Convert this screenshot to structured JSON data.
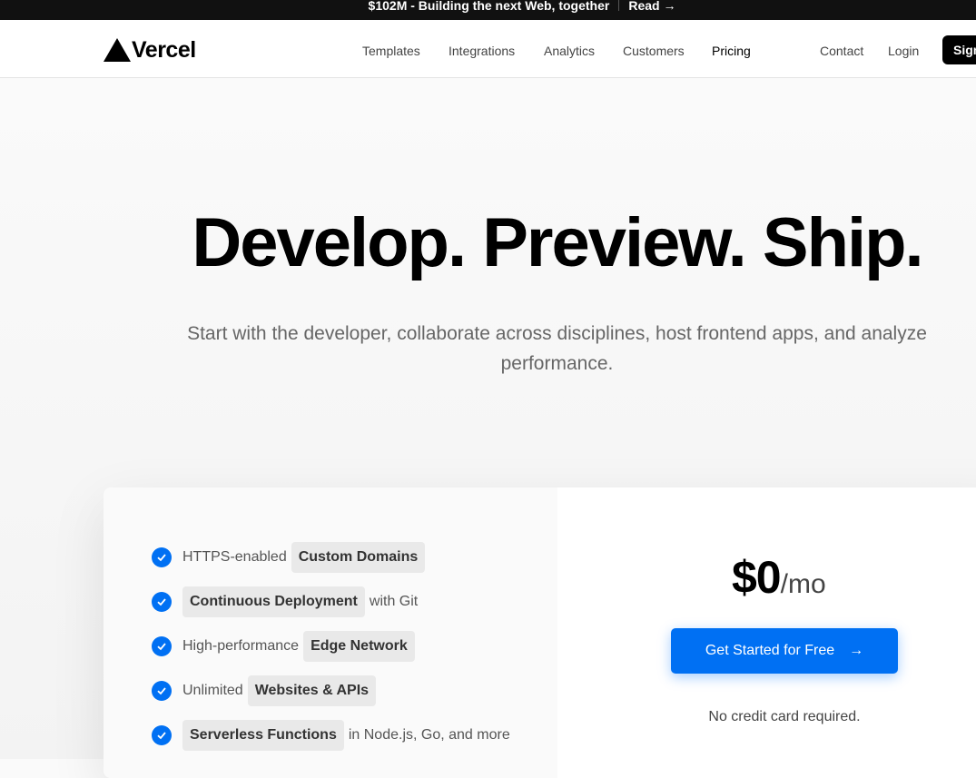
{
  "announcement": {
    "text": "$102M - Building the next Web, together",
    "link": "Read →"
  },
  "brand": {
    "name": "Vercel"
  },
  "nav": {
    "items": [
      {
        "label": "Templates"
      },
      {
        "label": "Integrations"
      },
      {
        "label": "Analytics"
      },
      {
        "label": "Customers"
      },
      {
        "label": "Pricing"
      }
    ],
    "contact": "Contact",
    "login": "Login",
    "signup": "Sign Up"
  },
  "hero": {
    "title": "Develop. Preview. Ship.",
    "subtitle": "Start with the developer, collaborate across disciplines, host frontend apps, and analyze performance."
  },
  "pricing": {
    "features": [
      {
        "before": "HTTPS-enabled",
        "highlight": "Custom Domains",
        "after": ""
      },
      {
        "before": "",
        "highlight": "Continuous Deployment",
        "after": "with Git"
      },
      {
        "before": "High-performance",
        "highlight": "Edge Network",
        "after": ""
      },
      {
        "before": "Unlimited",
        "highlight": "Websites & APIs",
        "after": ""
      },
      {
        "before": "",
        "highlight": "Serverless Functions",
        "after": "in Node.js, Go, and more"
      }
    ],
    "price": "$0",
    "period": "/mo",
    "cta": "Get Started for Free",
    "cta_arrow": "→",
    "note": "No credit card required."
  },
  "colors": {
    "accent": "#0070f3",
    "dark": "#111111"
  }
}
